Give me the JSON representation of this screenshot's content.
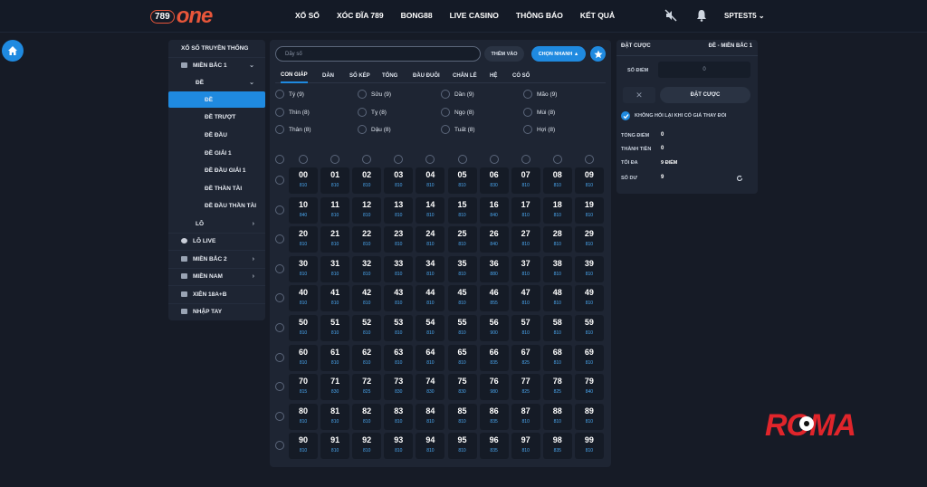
{
  "brand": {
    "logo_number": "789",
    "logo_word": "one"
  },
  "nav": [
    "XỔ SỐ",
    "XÓC ĐĨA 789",
    "BONG88",
    "LIVE CASINO",
    "THÔNG BÁO",
    "KẾT QUẢ"
  ],
  "user": {
    "name": "SPTEST5"
  },
  "sidebar": {
    "items": [
      {
        "label": "XỔ SỐ TRUYỀN THỐNG",
        "level": 0
      },
      {
        "label": "MIỀN BẮC 1",
        "level": 0
      },
      {
        "label": "ĐỀ",
        "level": 1
      },
      {
        "label": "ĐỀ",
        "level": 2
      },
      {
        "label": "ĐỀ TRƯỢT",
        "level": 2
      },
      {
        "label": "ĐỀ ĐẦU",
        "level": 2
      },
      {
        "label": "ĐỀ GIẢI 1",
        "level": 2
      },
      {
        "label": "ĐỀ ĐẦU GIẢI 1",
        "level": 2
      },
      {
        "label": "ĐỀ THẦN TÀI",
        "level": 2
      },
      {
        "label": "ĐỀ ĐẦU THẦN TÀI",
        "level": 2
      },
      {
        "label": "LÔ",
        "level": 1
      },
      {
        "label": "LÔ LIVE",
        "level": 0
      },
      {
        "label": "MIỀN BẮC 2",
        "level": 0
      },
      {
        "label": "MIỀN NAM",
        "level": 0
      },
      {
        "label": "XIÊN 18A+B",
        "level": 0
      },
      {
        "label": "NHẬP TAY",
        "level": 0
      }
    ]
  },
  "main": {
    "search_placeholder": "Dãy số",
    "add_label": "THÊM VÀO",
    "quick_label": "CHỌN NHANH",
    "tabs": [
      "CON GIÁP",
      "DÀN",
      "SỐ KÉP",
      "TỔNG",
      "ĐẦU ĐUÔI",
      "CHẴN LẺ",
      "HỆ",
      "CÓ SỐ"
    ],
    "zodiac": [
      "Tý (9)",
      "Sửu (9)",
      "Dần (9)",
      "Mão (9)",
      "Thìn (8)",
      "Tỵ (8)",
      "Ngọ (8)",
      "Mùi (8)",
      "Thân (8)",
      "Dậu (8)",
      "Tuất (8)",
      "Hợi (8)"
    ],
    "odds": [
      [
        "810",
        "810",
        "810",
        "810",
        "810",
        "810",
        "830",
        "810",
        "810",
        "810"
      ],
      [
        "840",
        "810",
        "810",
        "810",
        "810",
        "810",
        "840",
        "810",
        "810",
        "810"
      ],
      [
        "810",
        "810",
        "810",
        "810",
        "810",
        "810",
        "840",
        "810",
        "810",
        "810"
      ],
      [
        "810",
        "810",
        "810",
        "810",
        "810",
        "810",
        "880",
        "810",
        "810",
        "810"
      ],
      [
        "810",
        "810",
        "810",
        "810",
        "810",
        "810",
        "855",
        "810",
        "810",
        "810"
      ],
      [
        "810",
        "810",
        "810",
        "810",
        "810",
        "810",
        "900",
        "810",
        "810",
        "810"
      ],
      [
        "810",
        "810",
        "810",
        "810",
        "810",
        "810",
        "835",
        "825",
        "810",
        "810"
      ],
      [
        "815",
        "830",
        "825",
        "830",
        "830",
        "830",
        "980",
        "825",
        "825",
        "840"
      ],
      [
        "810",
        "810",
        "810",
        "810",
        "810",
        "810",
        "835",
        "810",
        "810",
        "810"
      ],
      [
        "810",
        "810",
        "810",
        "810",
        "810",
        "810",
        "835",
        "810",
        "835",
        "810"
      ]
    ]
  },
  "bet_panel": {
    "title": "ĐẶT CƯỢC",
    "subtitle": "ĐỀ - MIỀN BẮC 1",
    "points_label": "SỐ ĐIỂM",
    "points_value": "0",
    "clear_symbol": "✕",
    "bet_label": "ĐẶT CƯỢC",
    "no_ask_label": "KHÔNG HỎI LẠI KHI CÓ GIÁ THAY ĐỔI",
    "total_points_label": "TỔNG ĐIỂM",
    "total_points_value": "0",
    "amount_label": "THÀNH TIỀN",
    "amount_value": "0",
    "max_label": "TỐI ĐA",
    "max_value": "9 ĐIỂM",
    "balance_label": "SỐ DƯ",
    "balance_value": "9"
  },
  "watermark": {
    "text": "ROMA",
    "color": "#e0252b"
  },
  "colors": {
    "accent": "#1f8ae0",
    "brand": "#e8563a"
  }
}
